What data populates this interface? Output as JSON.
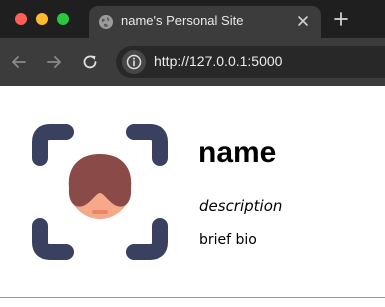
{
  "browser": {
    "tab": {
      "title": "name's Personal Site",
      "favicon": "globe-icon"
    },
    "address_bar": {
      "url": "http://127.0.0.1:5000"
    }
  },
  "profile": {
    "name": "name",
    "description": "description",
    "bio": "brief bio",
    "avatar": "face-scan-avatar"
  }
}
